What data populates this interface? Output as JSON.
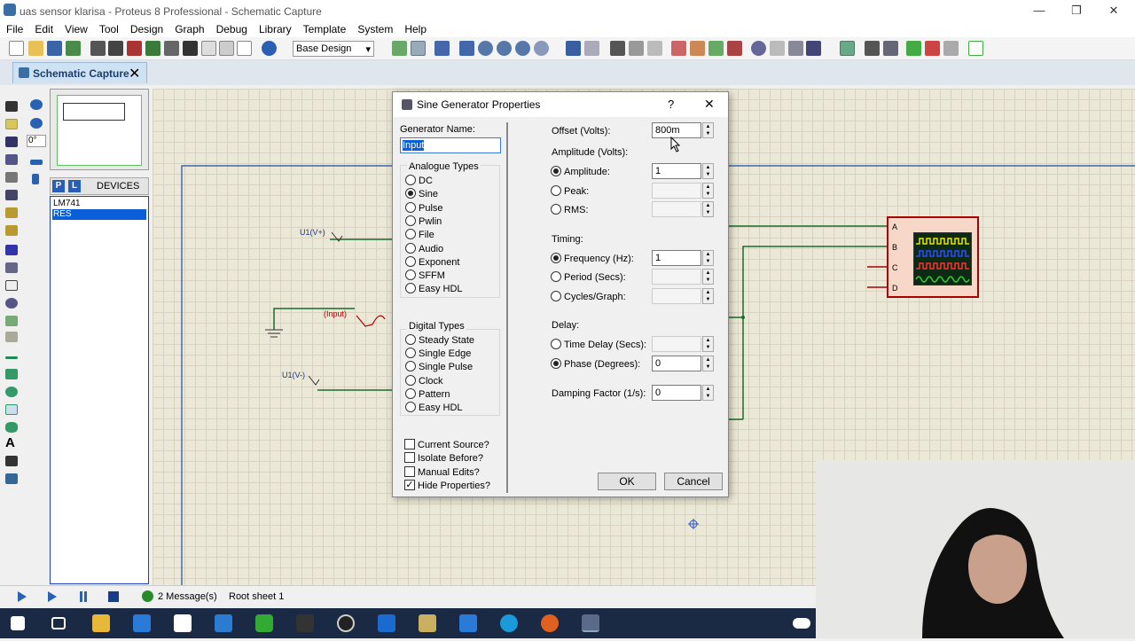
{
  "window": {
    "title": "uas sensor klarisa - Proteus 8 Professional - Schematic Capture",
    "min": "—",
    "max": "❐",
    "close": "✕"
  },
  "menu": [
    "File",
    "Edit",
    "View",
    "Tool",
    "Design",
    "Graph",
    "Debug",
    "Library",
    "Template",
    "System",
    "Help"
  ],
  "toolbar": {
    "design_select": "Base Design"
  },
  "tab": {
    "label": "Schematic Capture",
    "close": "✕"
  },
  "sidebar": {
    "angle": "0°",
    "devices_header": "DEVICES",
    "p_btn": "P",
    "l_btn": "L",
    "devices": [
      "LM741",
      "RES"
    ],
    "selected_device": "RES"
  },
  "schematic": {
    "labels": [
      "U1(V+)",
      "(Input)",
      "U1(V-)"
    ],
    "scope_channels": [
      "A",
      "B",
      "C",
      "D"
    ]
  },
  "dialog": {
    "title": "Sine Generator Properties",
    "help": "?",
    "close": "✕",
    "generator_name_label": "Generator Name:",
    "generator_name_value": "Input",
    "analogue_header": "Analogue Types",
    "analogue_types": [
      "DC",
      "Sine",
      "Pulse",
      "Pwlin",
      "File",
      "Audio",
      "Exponent",
      "SFFM",
      "Easy HDL"
    ],
    "analogue_selected": "Sine",
    "digital_header": "Digital Types",
    "digital_types": [
      "Steady State",
      "Single Edge",
      "Single Pulse",
      "Clock",
      "Pattern",
      "Easy HDL"
    ],
    "checks": [
      {
        "label": "Current Source?",
        "checked": false
      },
      {
        "label": "Isolate Before?",
        "checked": false
      },
      {
        "label": "Manual Edits?",
        "checked": false
      },
      {
        "label": "Hide Properties?",
        "checked": true
      }
    ],
    "offset_label": "Offset (Volts):",
    "offset_value": "800m",
    "amplitude_header": "Amplitude (Volts):",
    "amplitude_label": "Amplitude:",
    "amplitude_value": "1",
    "peak_label": "Peak:",
    "rms_label": "RMS:",
    "timing_header": "Timing:",
    "frequency_label": "Frequency (Hz):",
    "frequency_value": "1",
    "period_label": "Period (Secs):",
    "cycles_label": "Cycles/Graph:",
    "delay_header": "Delay:",
    "time_delay_label": "Time Delay (Secs):",
    "phase_label": "Phase (Degrees):",
    "phase_value": "0",
    "damping_label": "Damping Factor (1/s):",
    "damping_value": "0",
    "ok": "OK",
    "cancel": "Cancel"
  },
  "status": {
    "messages": "2 Message(s)",
    "sheet": "Root sheet 1"
  }
}
